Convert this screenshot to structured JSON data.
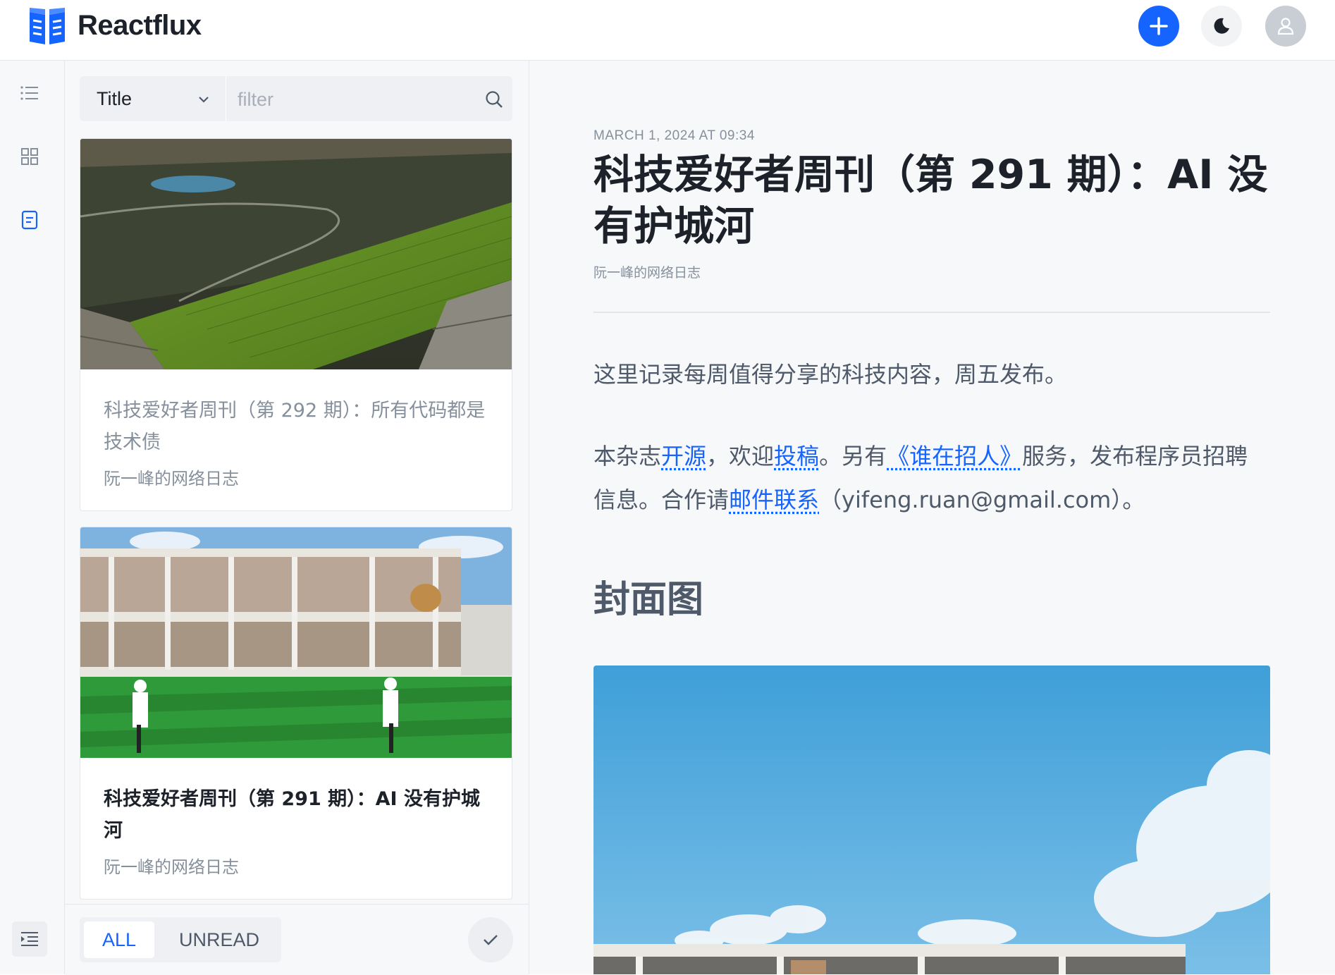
{
  "header": {
    "app_title": "Reactflux",
    "add_button_icon": "plus-icon",
    "theme_button_icon": "moon-icon",
    "avatar_icon": "user-icon",
    "accent": "#1664ff"
  },
  "nav_rail": {
    "items": [
      {
        "name": "list-icon",
        "active": false
      },
      {
        "name": "grid-icon",
        "active": false
      },
      {
        "name": "article-icon",
        "active": true
      }
    ],
    "collapse_icon": "indent-icon"
  },
  "search": {
    "field": "Title",
    "placeholder": "filter"
  },
  "articles": [
    {
      "title": "科技爱好者周刊（第 292 期）：所有代码都是技术债",
      "source": "阮一峰的网络日志",
      "read": true
    },
    {
      "title": "科技爱好者周刊（第 291 期）：AI 没有护城河",
      "source": "阮一峰的网络日志",
      "read": false
    }
  ],
  "filter_tabs": {
    "all": "ALL",
    "unread": "UNREAD",
    "selected": "ALL"
  },
  "reader": {
    "date": "MARCH 1, 2024 AT 09:34",
    "title": "科技爱好者周刊（第 291 期）：AI 没有护城河",
    "author": "阮一峰的网络日志",
    "para1": "这里记录每周值得分享的科技内容，周五发布。",
    "para2": {
      "t1": "本杂志",
      "l1": "开源",
      "t2": "，欢迎",
      "l2": "投稿",
      "t3": "。另有",
      "l3": "《谁在招人》",
      "t4": "服务，发布程序员招聘信息。合作请",
      "l4": "邮件联系",
      "t5": "（yifeng.ruan@gmail.com）。"
    },
    "heading": "封面图",
    "fab_icon": "eye-icon"
  }
}
